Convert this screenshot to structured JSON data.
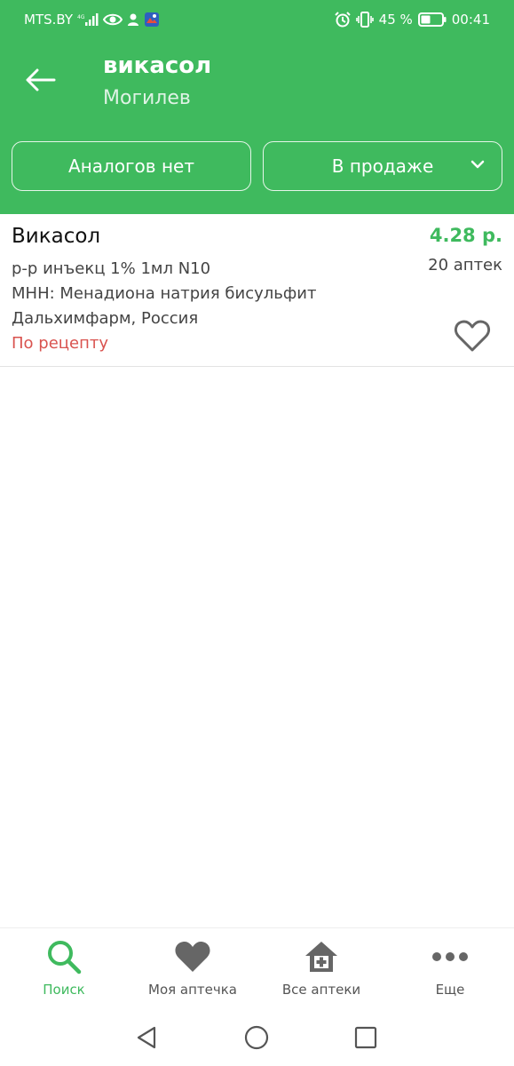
{
  "statusbar": {
    "carrier": "MTS.BY",
    "battery_percent": "45 %",
    "time": "00:41",
    "icons_left": [
      "signal-icon",
      "eye-icon",
      "person-icon",
      "app-icon"
    ],
    "icons_right": [
      "alarm-icon",
      "vibrate-icon",
      "battery-icon"
    ]
  },
  "header": {
    "back_icon": "arrow-left-icon",
    "title": "викасол",
    "subtitle": "Могилев",
    "background_color": "#3fba5e"
  },
  "filters": {
    "analogs_label": "Аналогов нет",
    "sale_label": "В продаже",
    "sale_icon": "chevron-down-icon"
  },
  "result": {
    "name": "Викасол",
    "price": "4.28 р.",
    "pharmacies": "20 аптек",
    "form": "р-р инъекц 1% 1мл N10",
    "inn": "МНН: Менадиона натрия бисульфит",
    "manufacturer": "Дальхимфарм, Россия",
    "prescription": "По рецепту",
    "favorite_icon": "heart-outline-icon",
    "price_color": "#3fba5e",
    "prescription_color": "#d9534f"
  },
  "bottom_nav": [
    {
      "label": "Поиск",
      "icon": "search-icon",
      "active": true
    },
    {
      "label": "Моя аптечка",
      "icon": "heart-icon",
      "active": false
    },
    {
      "label": "Все аптеки",
      "icon": "pharmacy-house-icon",
      "active": false
    },
    {
      "label": "Еще",
      "icon": "more-dots-icon",
      "active": false
    }
  ],
  "system_nav": [
    "back-triangle-icon",
    "home-circle-icon",
    "recent-square-icon"
  ]
}
